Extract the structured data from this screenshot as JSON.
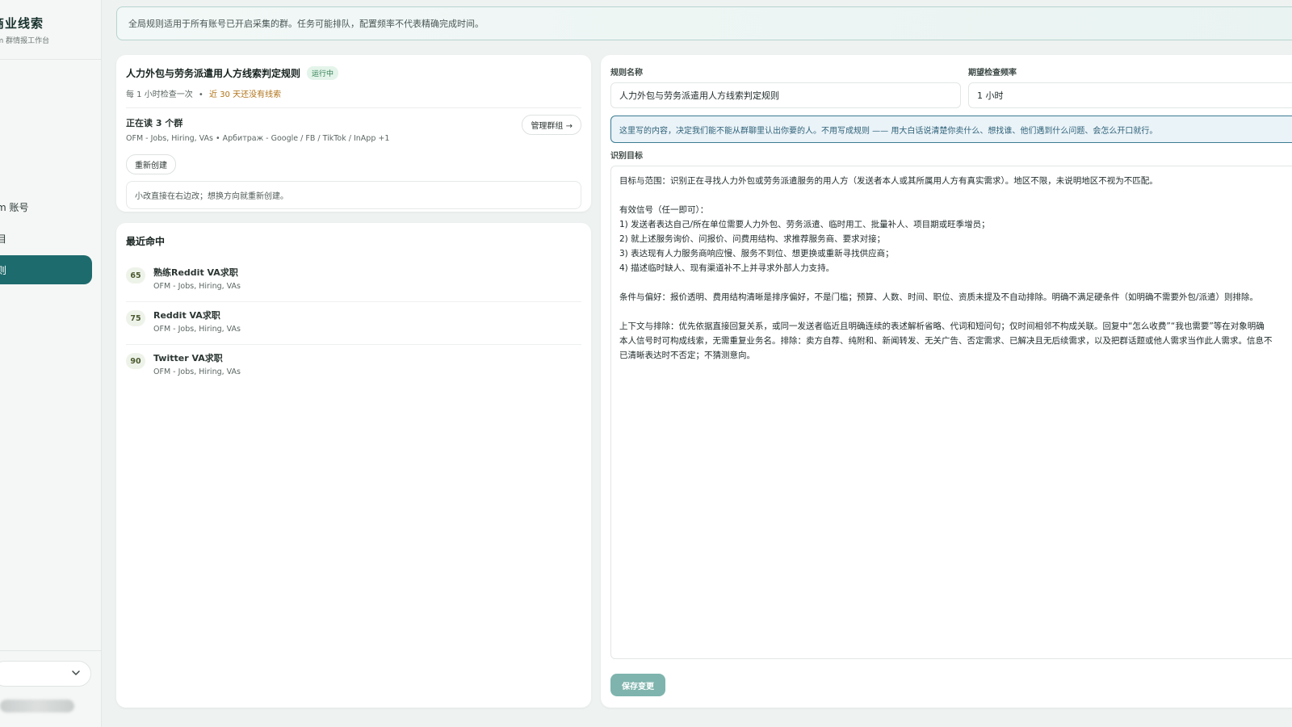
{
  "brand": {
    "title": "商业线索",
    "subtitle": "am  群情报工作台"
  },
  "sidebar": {
    "items": [
      {
        "label": "m 账号"
      },
      {
        "label": "目"
      },
      {
        "label": "则"
      }
    ]
  },
  "banner": {
    "text": "全局规则适用于所有账号已开启采集的群。任务可能排队，配置频率不代表精确完成时间。"
  },
  "rule": {
    "title": "人力外包与劳务派遣用人方线索判定规则",
    "status": "运行中",
    "meta_frequency": "每 1 小时检查一次",
    "meta_separator": "•",
    "meta_warning": "近 30 天还没有线索",
    "reading_title": "正在读 3 个群",
    "reading_groups": "OFM - Jobs, Hiring, VAs  •  Арбитраж - Google / FB / TikTok / InApp +1",
    "manage_label": "管理群组 →",
    "recreate_label": "重新创建",
    "hint": "小改直接在右边改；想换方向就重新创建。"
  },
  "hits": {
    "title": "最近命中",
    "items": [
      {
        "score": "65",
        "name": "熟练Reddit VA求职",
        "group": "OFM - Jobs, Hiring, VAs"
      },
      {
        "score": "75",
        "name": "Reddit VA求职",
        "group": "OFM - Jobs, Hiring, VAs"
      },
      {
        "score": "90",
        "name": "Twitter VA求职",
        "group": "OFM - Jobs, Hiring, VAs"
      }
    ]
  },
  "form": {
    "name_label": "规则名称",
    "name_value": "人力外包与劳务派遣用人方线索判定规则",
    "frequency_label": "期望检查频率",
    "frequency_value": "1 小时",
    "info": "这里写的内容，决定我们能不能从群聊里认出你要的人。不用写成规则 —— 用大白话说清楚你卖什么、想找谁、他们遇到什么问题、会怎么开口就行。",
    "target_label": "识别目标",
    "target_text": "目标与范围：识别正在寻找人力外包或劳务派遣服务的用人方（发送者本人或其所属用人方有真实需求）。地区不限，未说明地区不视为不匹配。\n\n有效信号（任一即可）：\n1) 发送者表达自己/所在单位需要人力外包、劳务派遣、临时用工、批量补人、项目期或旺季增员；\n2) 就上述服务询价、问报价、问费用结构、求推荐服务商、要求对接；\n3) 表达现有人力服务商响应慢、服务不到位、想更换或重新寻找供应商；\n4) 描述临时缺人、现有渠道补不上并寻求外部人力支持。\n\n条件与偏好：报价透明、费用结构清晰是排序偏好，不是门槛；预算、人数、时间、职位、资质未提及不自动排除。明确不满足硬条件（如明确不需要外包/派遣）则排除。\n\n上下文与排除：优先依据直接回复关系，或同一发送者临近且明确连续的表述解析省略、代词和短问句；仅时间相邻不构成关联。回复中“怎么收费”“我也需要”等在对象明确\n本人信号时可构成线索，无需重复业务名。排除：卖方自荐、纯附和、新闻转发、无关广告、否定需求、已解决且无后续需求，以及把群话题或他人需求当作此人需求。信息不\n已清晰表达时不否定；不猜测意向。",
    "save_label": "保存变更"
  }
}
